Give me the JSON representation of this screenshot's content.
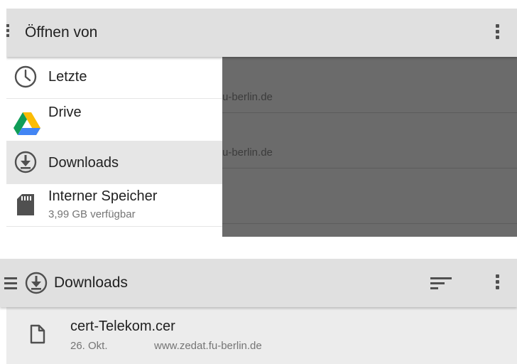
{
  "top_screen": {
    "title": "Öffnen von",
    "background_rows": [
      {
        "text": "u-berlin.de"
      },
      {
        "text": "u-berlin.de"
      }
    ],
    "drawer": {
      "items": [
        {
          "label": "Letzte",
          "icon": "clock-icon"
        },
        {
          "label": "Drive",
          "icon": "google-drive-icon"
        },
        {
          "label": "Downloads",
          "icon": "download-icon",
          "selected": true
        },
        {
          "label": "Interner Speicher",
          "sublabel": "3,99 GB verfügbar",
          "icon": "sd-card-icon"
        }
      ]
    }
  },
  "bottom_screen": {
    "title": "Downloads",
    "files": [
      {
        "name": "cert-Telekom.cer",
        "date": "26. Okt.",
        "source": "www.zedat.fu-berlin.de"
      }
    ]
  },
  "colors": {
    "appbar": "#e0e0e0",
    "scrim": "#6b6b6b",
    "selected_item": "#e6e6e6",
    "icon": "#505050",
    "drive_yellow": "#fbbc04",
    "drive_green": "#0f9d58",
    "drive_blue": "#4285f4"
  }
}
